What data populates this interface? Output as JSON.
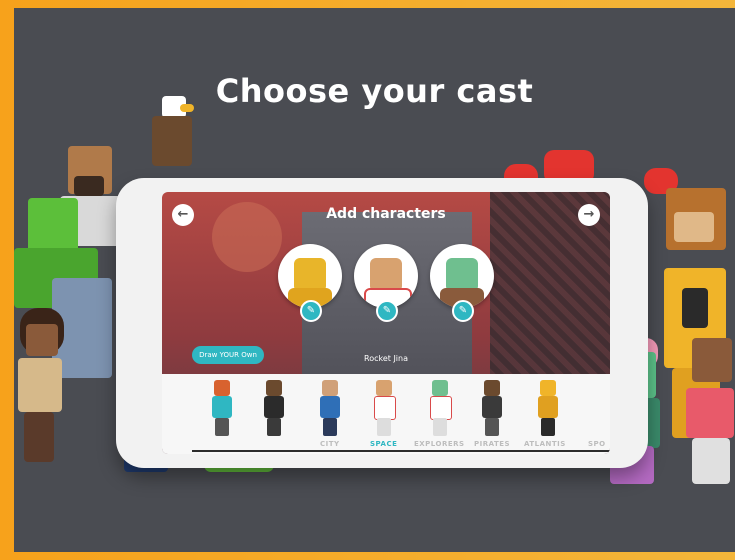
{
  "page": {
    "title": "Choose your cast"
  },
  "app_screen": {
    "title": "Add characters",
    "back_icon": "arrow-left-icon",
    "next_icon": "arrow-right-icon",
    "draw_button_label": "Draw YOUR Own",
    "selected_character_label": "Rocket Jina",
    "selected_characters": [
      {
        "color_head": "#e8b52a",
        "color_body": "#e0a41e"
      },
      {
        "color_head": "#d8a26f",
        "color_body": "#ffffff"
      },
      {
        "color_head": "#6fbf8f",
        "color_body": "#8a5b3c"
      }
    ],
    "categories": [
      "CITY",
      "SPACE",
      "EXPLORERS",
      "PIRATES",
      "ATLANTIS",
      "SPO"
    ],
    "active_category": "SPACE"
  },
  "colors": {
    "accent": "#2fb7c2",
    "background": "#4a4c52",
    "frame": "#f5a623"
  }
}
